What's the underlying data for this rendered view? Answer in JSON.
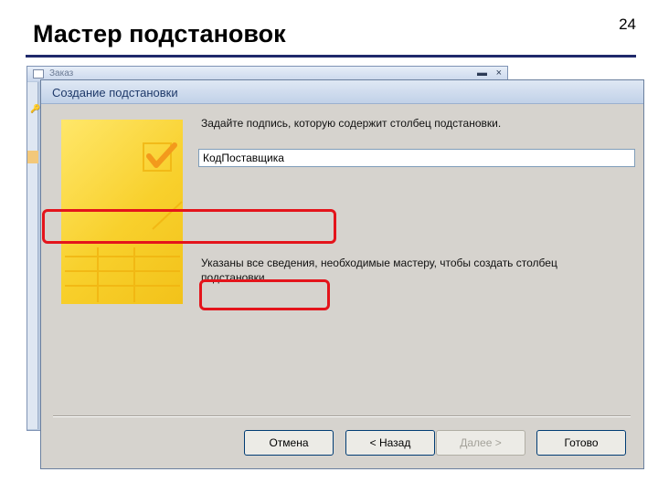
{
  "slide": {
    "title": "Мастер подстановок",
    "page_number": "24"
  },
  "background_window": {
    "title": "Заказ"
  },
  "dialog": {
    "title": "Создание подстановки",
    "prompt": "Задайте подпись, которую содержит столбец подстановки.",
    "caption_value": "КодПоставщика",
    "info_line1": "Указаны все сведения, необходимые мастеру, чтобы создать столбец",
    "info_line2": "подстановки.",
    "buttons": {
      "cancel": "Отмена",
      "back": "< Назад",
      "next": "Далее >",
      "finish": "Готово"
    }
  },
  "colors": {
    "highlight": "#e4141b",
    "title_rule": "#1f2a6b",
    "wizard_yellow": "#f8d02c"
  }
}
